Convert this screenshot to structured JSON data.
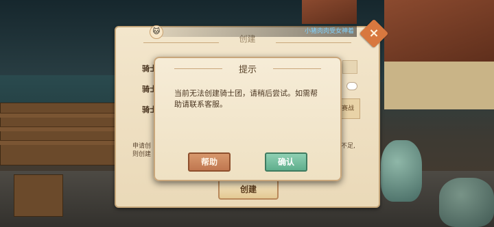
{
  "panel": {
    "title": "创建",
    "close_icon": "×",
    "field_labels": [
      "骑士",
      "骑士",
      "骑士"
    ],
    "note_lines": [
      "申请创",
      "则创建"
    ],
    "note_right_lines": [
      "不足,",
      ""
    ],
    "tag_text": "赛战",
    "create_button": "创建"
  },
  "banner": {
    "avatar_icon": "cat-face-icon",
    "text": "小猪肉肉受女神着"
  },
  "dialog": {
    "title": "提示",
    "message": "当前无法创建骑士团，请稍后尝试。如需帮助请联系客服。",
    "help_button": "帮助",
    "confirm_button": "确认"
  },
  "colors": {
    "help_button": "#c07750",
    "confirm_button": "#5fae8c",
    "close_button": "#d8783f"
  }
}
